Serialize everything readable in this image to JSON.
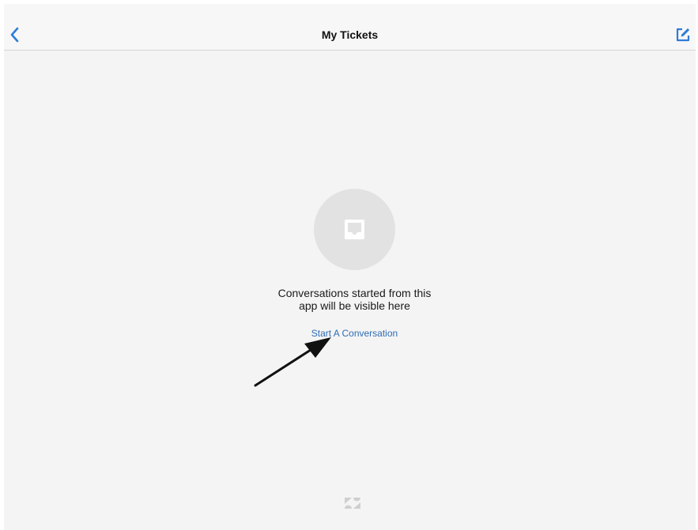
{
  "header": {
    "title": "My Tickets",
    "back_icon": "chevron-left-icon",
    "compose_icon": "compose-icon"
  },
  "empty_state": {
    "icon": "inbox-icon",
    "message_line1": "Conversations started from this",
    "message_line2": "app will be visible here",
    "action_label": "Start A Conversation"
  },
  "footer": {
    "logo_icon": "zendesk-logo-icon"
  },
  "colors": {
    "accent": "#2f7bd9",
    "link": "#2f6db4",
    "background": "#f4f4f4",
    "nav_background": "#f7f7f7",
    "icon_circle": "#e2e2e2"
  }
}
